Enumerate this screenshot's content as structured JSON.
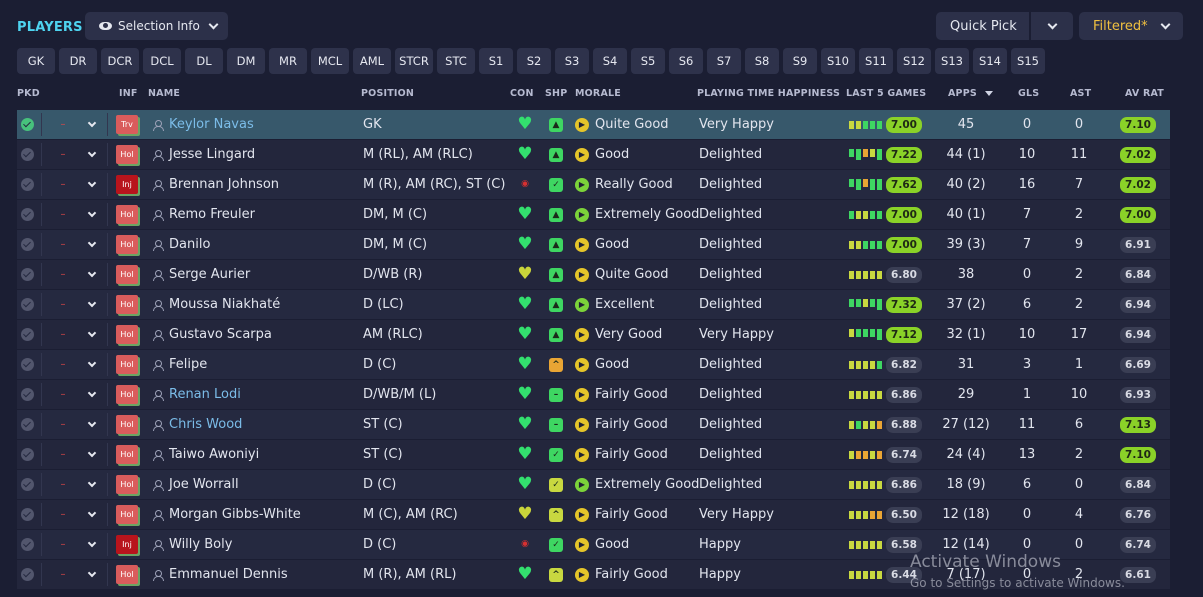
{
  "header": {
    "title": "PLAYERS",
    "selection_button": "Selection Info",
    "quick_pick": "Quick Pick",
    "filter": "Filtered*"
  },
  "views": [
    "GK",
    "DR",
    "DCR",
    "DCL",
    "DL",
    "DM",
    "MR",
    "MCL",
    "AML",
    "STCR",
    "STC",
    "S1",
    "S2",
    "S3",
    "S4",
    "S5",
    "S6",
    "S7",
    "S8",
    "S9",
    "S10",
    "S11",
    "S12",
    "S13",
    "S14",
    "S15"
  ],
  "columns": {
    "pkd": "PKD",
    "inf": "INF",
    "name": "NAME",
    "position": "POSITION",
    "con": "CON",
    "shp": "SHP",
    "morale": "MORALE",
    "happiness": "PLAYING TIME HAPPINESS",
    "last5": "LAST 5 GAMES",
    "apps": "APPS",
    "gls": "GLS",
    "ast": "AST",
    "avrat": "AV RAT"
  },
  "rows": [
    {
      "inf": "Trv",
      "name": "Keylor Navas",
      "position": "GK",
      "morale": "Quite Good",
      "happiness": "Very Happy",
      "last5": "7.00",
      "apps": "45",
      "gls": "0",
      "ast": "0",
      "avrat": "7.10"
    },
    {
      "inf": "Hol",
      "name": "Jesse Lingard",
      "position": "M (RL), AM (RLC)",
      "morale": "Good",
      "happiness": "Delighted",
      "last5": "7.22",
      "apps": "44 (1)",
      "gls": "10",
      "ast": "11",
      "avrat": "7.02"
    },
    {
      "inf": "Inj",
      "name": "Brennan Johnson",
      "position": "M (R), AM (RC), ST (C)",
      "morale": "Really Good",
      "happiness": "Delighted",
      "last5": "7.62",
      "apps": "40 (2)",
      "gls": "16",
      "ast": "7",
      "avrat": "7.02"
    },
    {
      "inf": "Hol",
      "name": "Remo Freuler",
      "position": "DM, M (C)",
      "morale": "Extremely Good",
      "happiness": "Delighted",
      "last5": "7.00",
      "apps": "40 (1)",
      "gls": "7",
      "ast": "2",
      "avrat": "7.00"
    },
    {
      "inf": "Hol",
      "name": "Danilo",
      "position": "DM, M (C)",
      "morale": "Good",
      "happiness": "Delighted",
      "last5": "7.00",
      "apps": "39 (3)",
      "gls": "7",
      "ast": "9",
      "avrat": "6.91"
    },
    {
      "inf": "Hol",
      "name": "Serge Aurier",
      "position": "D/WB (R)",
      "morale": "Quite Good",
      "happiness": "Delighted",
      "last5": "6.80",
      "apps": "38",
      "gls": "0",
      "ast": "2",
      "avrat": "6.84"
    },
    {
      "inf": "Hol",
      "name": "Moussa Niakhaté",
      "position": "D (LC)",
      "morale": "Excellent",
      "happiness": "Delighted",
      "last5": "7.32",
      "apps": "37 (2)",
      "gls": "6",
      "ast": "2",
      "avrat": "6.94"
    },
    {
      "inf": "Hol",
      "name": "Gustavo Scarpa",
      "position": "AM (RLC)",
      "morale": "Very Good",
      "happiness": "Very Happy",
      "last5": "7.12",
      "apps": "32 (1)",
      "gls": "10",
      "ast": "17",
      "avrat": "6.94"
    },
    {
      "inf": "Hol",
      "name": "Felipe",
      "position": "D (C)",
      "morale": "Good",
      "happiness": "Delighted",
      "last5": "6.82",
      "apps": "31",
      "gls": "3",
      "ast": "1",
      "avrat": "6.69"
    },
    {
      "inf": "Hol",
      "name": "Renan Lodi",
      "position": "D/WB/M (L)",
      "morale": "Fairly Good",
      "happiness": "Delighted",
      "last5": "6.86",
      "apps": "29",
      "gls": "1",
      "ast": "10",
      "avrat": "6.93"
    },
    {
      "inf": "Hol",
      "name": "Chris Wood",
      "position": "ST (C)",
      "morale": "Fairly Good",
      "happiness": "Delighted",
      "last5": "6.88",
      "apps": "27 (12)",
      "gls": "11",
      "ast": "6",
      "avrat": "7.13"
    },
    {
      "inf": "Hol",
      "name": "Taiwo Awoniyi",
      "position": "ST (C)",
      "morale": "Fairly Good",
      "happiness": "Delighted",
      "last5": "6.74",
      "apps": "24 (4)",
      "gls": "13",
      "ast": "2",
      "avrat": "7.10"
    },
    {
      "inf": "Hol",
      "name": "Joe Worrall",
      "position": "D (C)",
      "morale": "Extremely Good",
      "happiness": "Delighted",
      "last5": "6.86",
      "apps": "18 (9)",
      "gls": "6",
      "ast": "0",
      "avrat": "6.84"
    },
    {
      "inf": "Hol",
      "name": "Morgan Gibbs-White",
      "position": "M (C), AM (RC)",
      "morale": "Fairly Good",
      "happiness": "Very Happy",
      "last5": "6.50",
      "apps": "12 (18)",
      "gls": "0",
      "ast": "4",
      "avrat": "6.76"
    },
    {
      "inf": "Inj",
      "name": "Willy Boly",
      "position": "D (C)",
      "morale": "Good",
      "happiness": "Happy",
      "last5": "6.58",
      "apps": "12 (14)",
      "gls": "0",
      "ast": "0",
      "avrat": "6.74"
    },
    {
      "inf": "Hol",
      "name": "Emmanuel Dennis",
      "position": "M (R), AM (RL)",
      "morale": "Fairly Good",
      "happiness": "Happy",
      "last5": "6.44",
      "apps": "7 (17)",
      "gls": "0",
      "ast": "2",
      "avrat": "6.61"
    }
  ],
  "watermark": {
    "line1": "Activate Windows",
    "line2": "Go to Settings to activate Windows."
  }
}
